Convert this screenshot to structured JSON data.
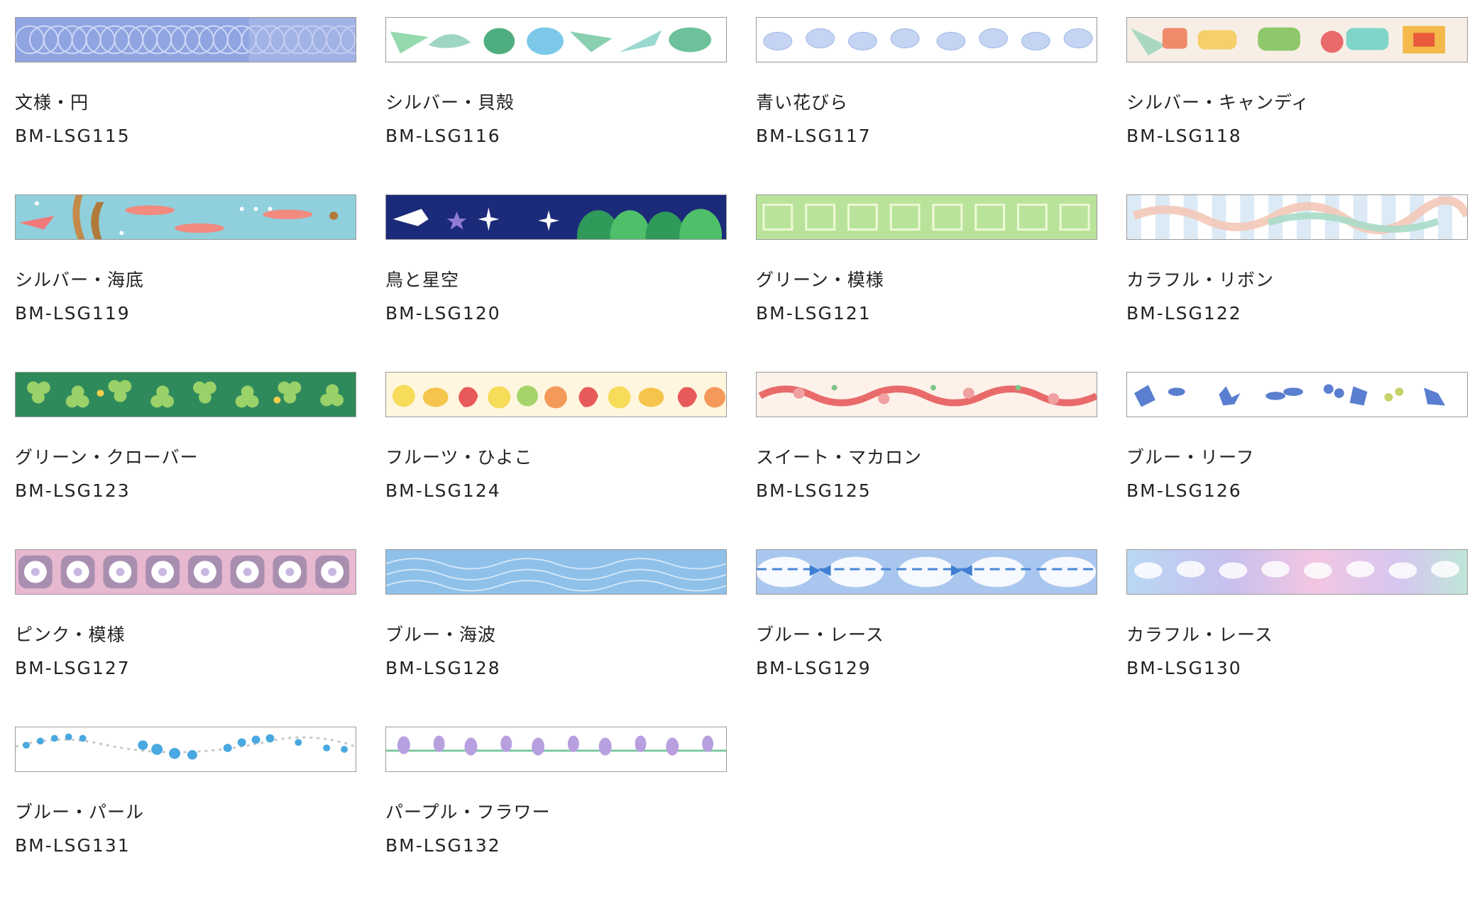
{
  "products": [
    {
      "name": "文様・円",
      "code": "BM-LSG115",
      "pattern": "circles-pattern",
      "bg": "#8fa4e0"
    },
    {
      "name": "シルバー・貝殻",
      "code": "BM-LSG116",
      "pattern": "shells",
      "bg": "#ffffff"
    },
    {
      "name": "青い花びら",
      "code": "BM-LSG117",
      "pattern": "blue-petals",
      "bg": "#ffffff"
    },
    {
      "name": "シルバー・キャンディ",
      "code": "BM-LSG118",
      "pattern": "candy",
      "bg": "#f7efe6"
    },
    {
      "name": "シルバー・海底",
      "code": "BM-LSG119",
      "pattern": "sea-fish",
      "bg": "#8fd0dc"
    },
    {
      "name": "鳥と星空",
      "code": "BM-LSG120",
      "pattern": "bird-starry-sky",
      "bg": "#1c2a7a"
    },
    {
      "name": "グリーン・模様",
      "code": "BM-LSG121",
      "pattern": "green-pattern",
      "bg": "#b9e39a"
    },
    {
      "name": "カラフル・リボン",
      "code": "BM-LSG122",
      "pattern": "colorful-ribbon",
      "bg": "#ffffff"
    },
    {
      "name": "グリーン・クローバー",
      "code": "BM-LSG123",
      "pattern": "clover",
      "bg": "#2f8a5b"
    },
    {
      "name": "フルーツ・ひよこ",
      "code": "BM-LSG124",
      "pattern": "fruit-chick",
      "bg": "#fff6df"
    },
    {
      "name": "スイート・マカロン",
      "code": "BM-LSG125",
      "pattern": "macaron",
      "bg": "#fdf1ea"
    },
    {
      "name": "ブルー・リーフ",
      "code": "BM-LSG126",
      "pattern": "blue-leaf",
      "bg": "#ffffff"
    },
    {
      "name": "ピンク・模様",
      "code": "BM-LSG127",
      "pattern": "pink-pattern",
      "bg": "#e8b7d0"
    },
    {
      "name": "ブルー・海波",
      "code": "BM-LSG128",
      "pattern": "blue-waves",
      "bg": "#8ec0ea"
    },
    {
      "name": "ブルー・レース",
      "code": "BM-LSG129",
      "pattern": "blue-lace",
      "bg": "#a9c6ee"
    },
    {
      "name": "カラフル・レース",
      "code": "BM-LSG130",
      "pattern": "colorful-lace",
      "bg": "#c8d8f0"
    },
    {
      "name": "ブルー・パール",
      "code": "BM-LSG131",
      "pattern": "blue-pearl",
      "bg": "#ffffff"
    },
    {
      "name": "パープル・フラワー",
      "code": "BM-LSG132",
      "pattern": "purple-flower",
      "bg": "#ffffff"
    }
  ]
}
